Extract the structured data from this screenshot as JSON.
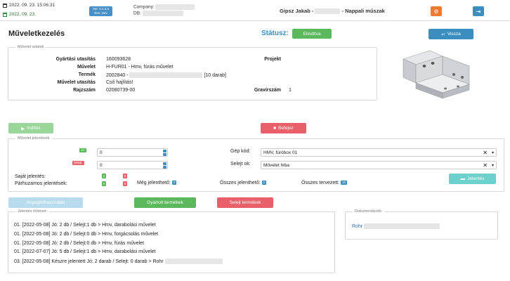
{
  "header": {
    "datetime": "2022. 09. 23. 15:06:31",
    "date": "2022. 09. 23.",
    "version_line1": "Ver: 0.1.3.4",
    "version_line2": "Env: Dev",
    "company_label": "Company:",
    "db_label": "DB:",
    "user_name": "Gipsz Jakab -",
    "shift": "- Nappali műszak",
    "settings_color": "#f07a32",
    "logout_color": "#3a8ec0"
  },
  "page": {
    "title": "Műveletkezelés",
    "status_label": "Státusz:",
    "status_value": "Elindítva",
    "back_label": "Vissza"
  },
  "operation_data": {
    "legend": "Művelet adatok",
    "rows": [
      {
        "label": "Gyártási utasítás",
        "value": "160093628"
      },
      {
        "label": "Művelet",
        "value": "H-FUR01 - Hmv, fúrás művelet"
      },
      {
        "label": "Termék",
        "value": "2002840 -",
        "suffix": "[10 darab]"
      },
      {
        "label": "Művelet utasítás",
        "value": "Cső hajlítás!"
      },
      {
        "label": "Rajzszám",
        "value": "02080739-00"
      }
    ],
    "project_label": "Projekt",
    "engraving_label": "Gravírszám",
    "engraving_value": "1"
  },
  "actions": {
    "start_label": "Indítás",
    "finish_label": "Befejez"
  },
  "reporting": {
    "legend": "Művelet jelentések",
    "good_badge": "Jó:",
    "scrap_badge": "Selejt:",
    "good_value": "0",
    "scrap_value": "0",
    "machine_label": "Gép kód:",
    "machine_value": "HMV, fúróbox 01",
    "scrap_reason_label": "Selejt ok:",
    "scrap_reason_value": "Művelet hiba",
    "own_report_label": "Saját jelentés:",
    "parallel_report_label": "Párhuzamos jelentések:",
    "own_good": "2",
    "own_scrap": "0",
    "parallel_good": "0",
    "parallel_scrap": "0",
    "still_reportable_label": "Még jelenthető:",
    "still_reportable_value": "0",
    "total_reportable_label": "Összes jelenthető:",
    "total_reportable_value": "2",
    "total_planned_label": "Összes tervezett:",
    "total_planned_value": "10",
    "report_button": "Jelentés"
  },
  "bottom_buttons": {
    "material_label": "Anyagfelhasználás",
    "produced_label": "Gyártott termékek",
    "scrap_products_label": "Selejt termékek"
  },
  "history": {
    "legend": "Jelentés történet:",
    "lines": [
      "01. [2022-05-08] Jó: 2 db / Selejt:1 db > Hmv, darabolási művelet",
      "01. [2022-05-08] Jó: 2 db / Selejt:0 db > Hmv, forgácsolás művelet",
      "01. [2022-05-08] Jó: 2 db / Selejt:0 db > Hmv, fúrás művelet",
      "01. [2022-07-07] Jó: 5 db / Selejt:1 db > Hmv, darabolási művelet",
      "03. [2022-05-08] Készre jelentett Jó: 2 darab / Selejt: 0 darab > Rohr"
    ]
  },
  "documents": {
    "legend": "Dokumentációk:",
    "link_text": "Rohr"
  }
}
